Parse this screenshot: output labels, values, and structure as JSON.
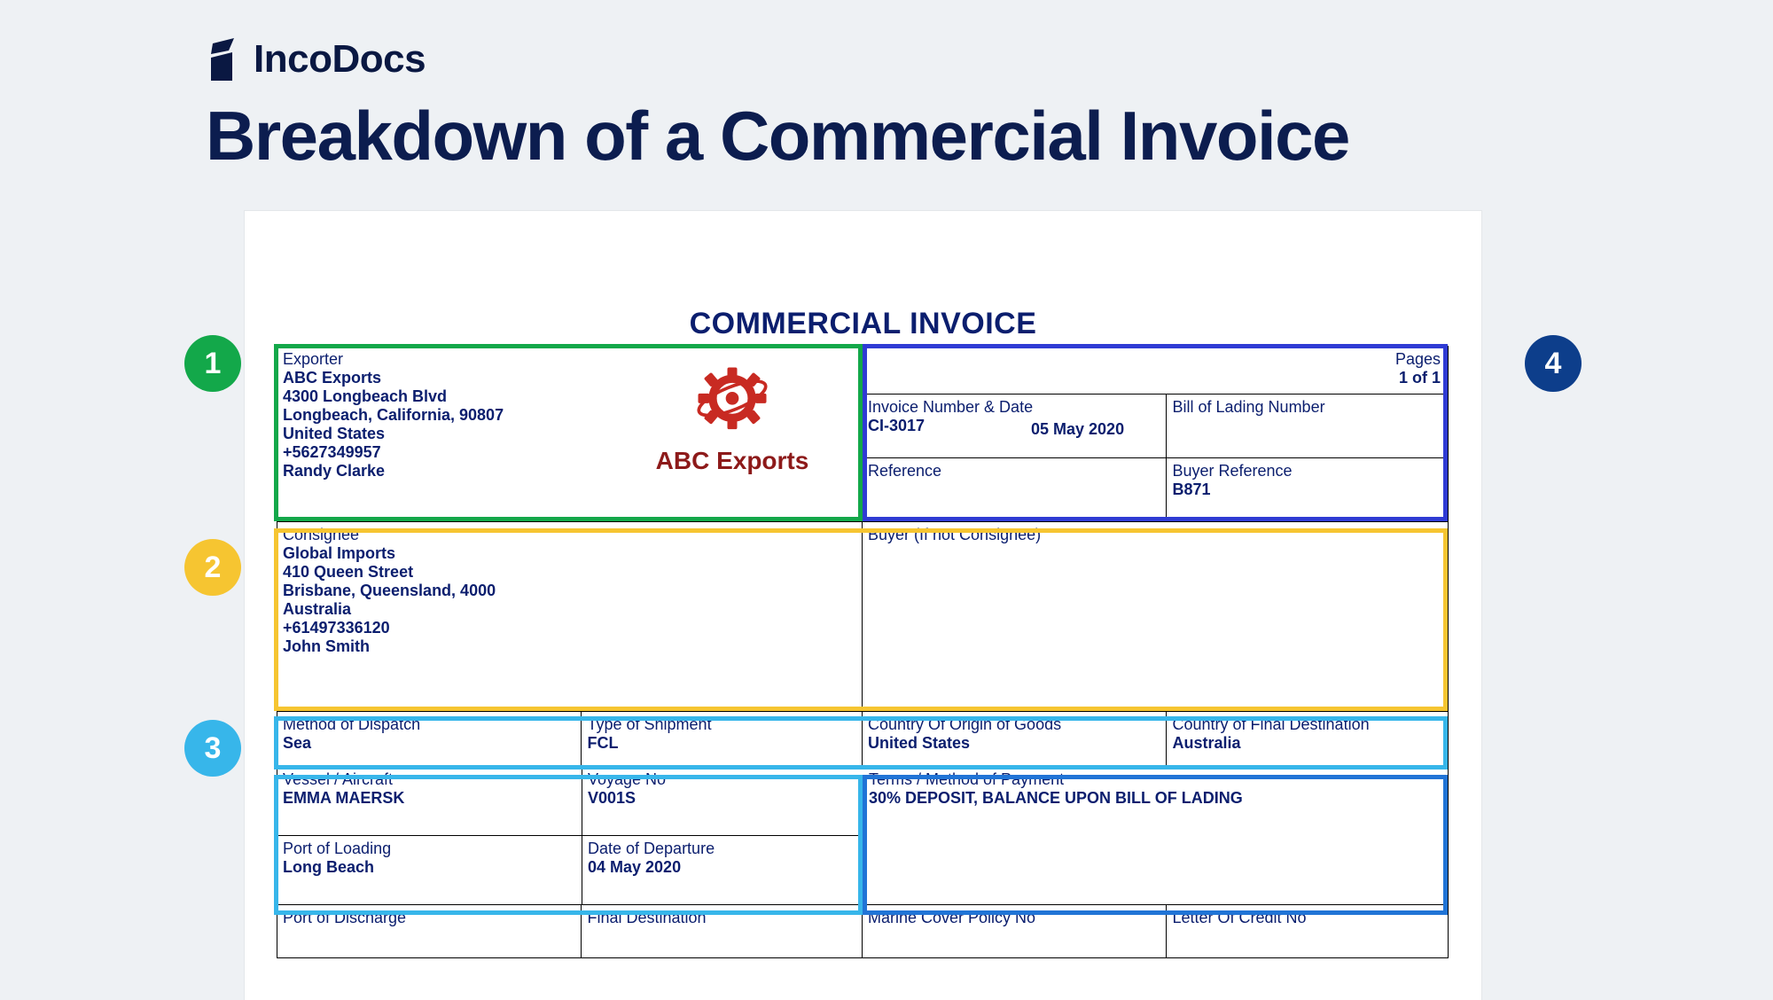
{
  "brand": {
    "name": "IncoDocs"
  },
  "title": "Breakdown of a Commercial Invoice",
  "doc_title": "COMMERCIAL INVOICE",
  "badges": {
    "n1": "1",
    "n2": "2",
    "n3": "3",
    "n4": "4"
  },
  "exporter": {
    "label": "Exporter",
    "name": "ABC Exports",
    "addr1": "4300 Longbeach Blvd",
    "addr2": "Longbeach, California, 90807",
    "country": "United States",
    "phone": "+5627349957",
    "contact": "Randy Clarke",
    "logo_name": "ABC Exports"
  },
  "pages": {
    "label": "Pages",
    "value": "1 of 1"
  },
  "inv": {
    "num_label": "Invoice Number & Date",
    "num": "CI-3017",
    "date": "05 May 2020",
    "bol_label": "Bill of Lading Number",
    "bol": "",
    "ref_label": "Reference",
    "ref": "",
    "buyer_ref_label": "Buyer Reference",
    "buyer_ref": "B871"
  },
  "consignee": {
    "label": "Consignee",
    "name": "Global Imports",
    "addr1": "410 Queen Street",
    "addr2": "Brisbane, Queensland, 4000",
    "country": "Australia",
    "phone": "+61497336120",
    "contact": "John Smith"
  },
  "buyer": {
    "label": "Buyer (If not Consignee)",
    "value": ""
  },
  "ship": {
    "method_label": "Method of Dispatch",
    "method": "Sea",
    "type_label": "Type of Shipment",
    "type": "FCL",
    "origin_label": "Country Of Origin of Goods",
    "origin": "United States",
    "dest_label": "Country of Final Destination",
    "dest": "Australia",
    "vessel_label": "Vessel / Aircraft",
    "vessel": "EMMA MAERSK",
    "voyage_label": "Voyage No",
    "voyage": "V001S",
    "terms_label": "Terms / Method of Payment",
    "terms": "30% DEPOSIT, BALANCE UPON BILL OF LADING",
    "pol_label": "Port of Loading",
    "pol": "Long Beach",
    "dep_label": "Date of Departure",
    "dep": "04 May 2020",
    "pod_label": "Port of Discharge",
    "pod": "",
    "fdest_label": "Final Destination",
    "fdest": "",
    "marine_label": "Marine Cover Policy No",
    "marine": "",
    "lc_label": "Letter Of Credit No",
    "lc": ""
  }
}
